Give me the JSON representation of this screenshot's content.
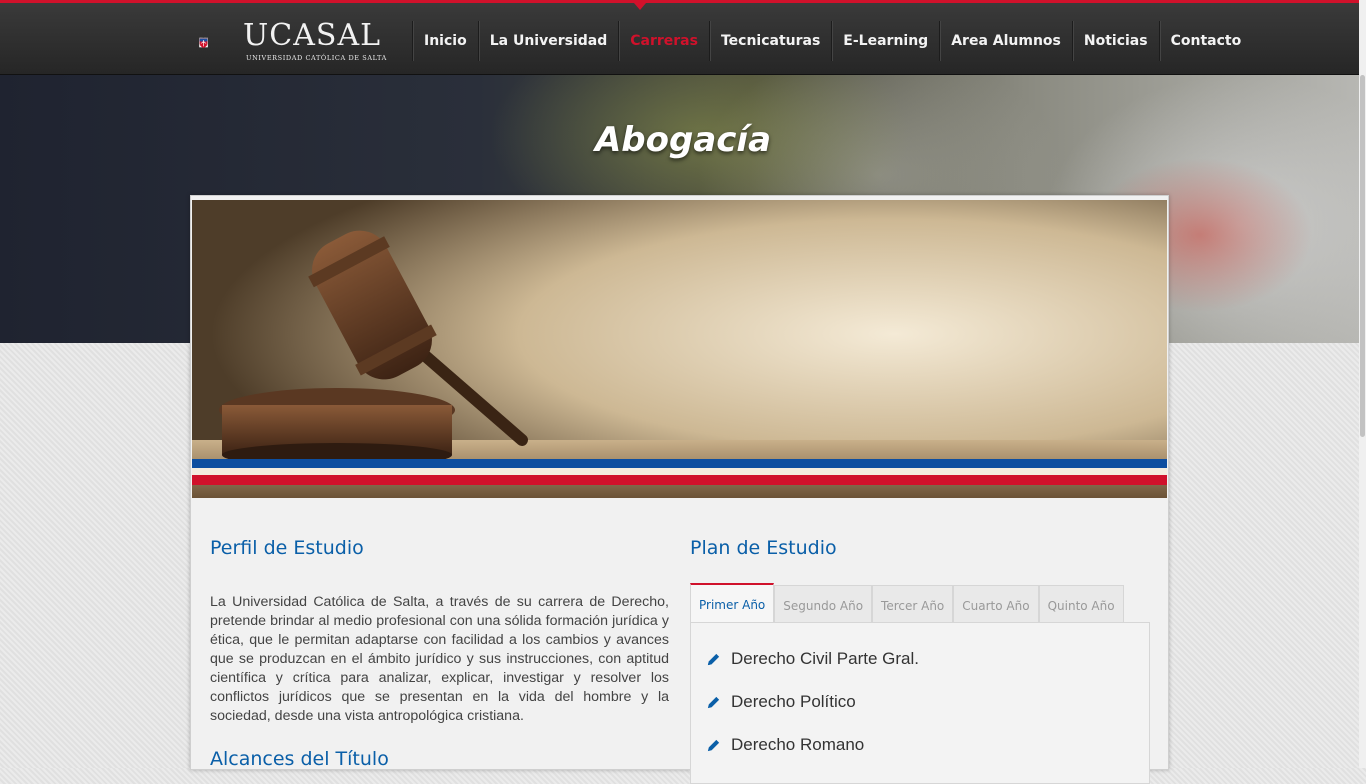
{
  "brand": {
    "name": "UCASAL",
    "subtitle": "UNIVERSIDAD CATÓLICA DE SALTA",
    "colors": {
      "red": "#d0112b",
      "blue": "#0a5fa8"
    }
  },
  "nav": {
    "items": [
      {
        "label": "Inicio",
        "active": false
      },
      {
        "label": "La Universidad",
        "active": false
      },
      {
        "label": "Carreras",
        "active": true
      },
      {
        "label": "Tecnicaturas",
        "active": false
      },
      {
        "label": "E-Learning",
        "active": false
      },
      {
        "label": "Area Alumnos",
        "active": false
      },
      {
        "label": "Noticias",
        "active": false
      },
      {
        "label": "Contacto",
        "active": false
      }
    ]
  },
  "page": {
    "title": "Abogacía"
  },
  "profile": {
    "heading": "Perfil de Estudio",
    "text": "La Universidad Católica de Salta, a través de su carrera de Derecho, pretende brindar al medio profesional con una sólida formación jurídica y ética, que le permitan adaptarse con facilidad a los cambios y avances que se produzcan en el ámbito jurídico y sus instrucciones, con aptitud científica y crítica para analizar, explicar, investigar y resolver los conflictos jurídicos que se presentan en la vida del hombre y la sociedad, desde una vista antropológica cristiana.",
    "scope_heading": "Alcances del Título"
  },
  "plan": {
    "heading": "Plan de Estudio",
    "tabs": [
      "Primer Año",
      "Segundo Año",
      "Tercer Año",
      "Cuarto Año",
      "Quinto Año"
    ],
    "active_tab": "Primer Año",
    "subjects": [
      "Derecho Civil Parte Gral.",
      "Derecho Político",
      "Derecho Romano"
    ],
    "subject_icon": "pencil-icon"
  }
}
